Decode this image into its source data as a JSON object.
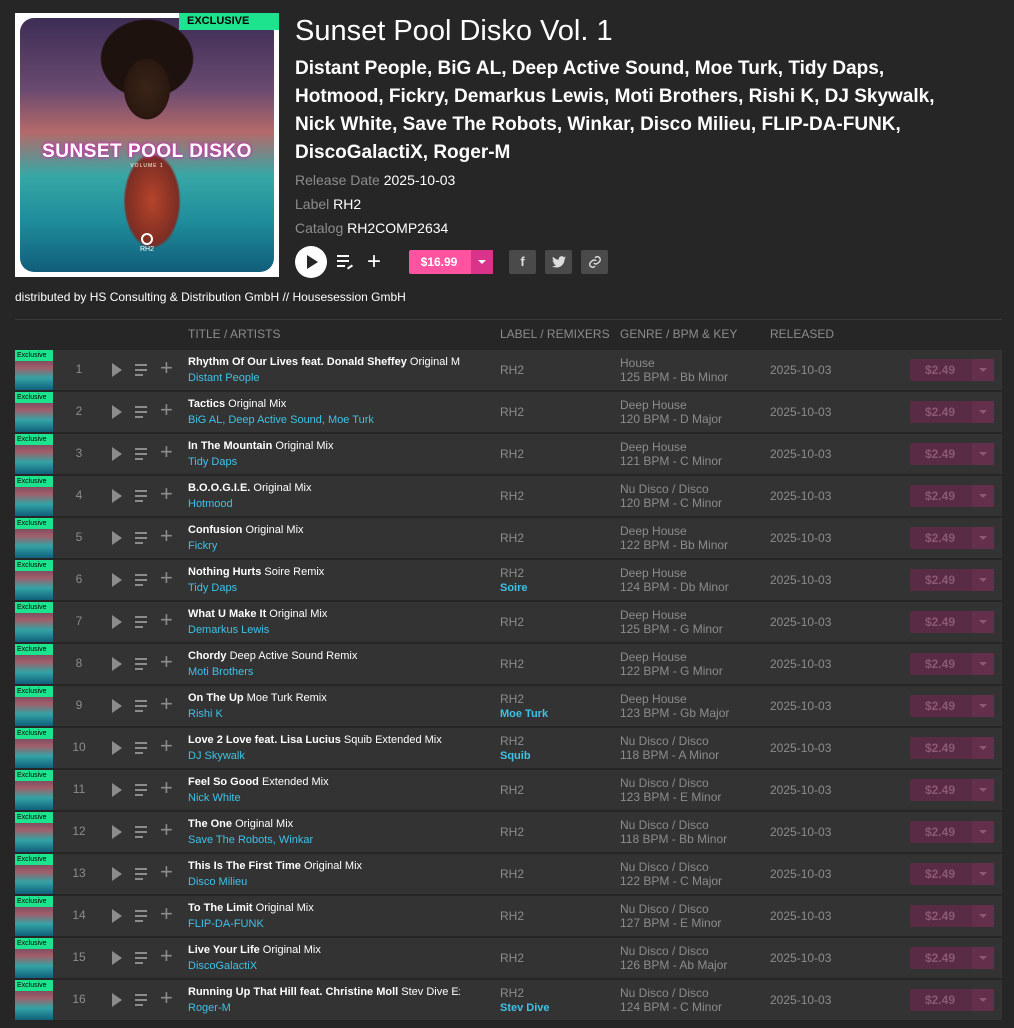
{
  "release": {
    "exclusive_tag": "EXCLUSIVE",
    "cover_title": "SUNSET POOL DISKO",
    "cover_subtitle": "VOLUME 1",
    "cover_logo": "RH2",
    "title": "Sunset Pool Disko Vol. 1",
    "artists": "Distant People, BiG AL, Deep Active Sound, Moe Turk, Tidy Daps, Hotmood, Fickry, Demarkus Lewis, Moti Brothers, Rishi K, DJ Skywalk, Nick White, Save The Robots, Winkar, Disco Milieu, FLIP-DA-FUNK, DiscoGalactiX, Roger-M",
    "release_date_label": "Release Date",
    "release_date": "2025-10-03",
    "label_label": "Label",
    "label": "RH2",
    "catalog_label": "Catalog",
    "catalog": "RH2COMP2634",
    "price": "$16.99",
    "distributed_by": "distributed by HS Consulting & Distribution GmbH // Housesession GmbH"
  },
  "social": {
    "facebook": "f",
    "twitter": "t",
    "link": "link"
  },
  "columns": {
    "title": "TITLE / ARTISTS",
    "label": "LABEL / REMIXERS",
    "genre": "GENRE / BPM & KEY",
    "released": "RELEASED"
  },
  "colors": {
    "accent_green": "#1ee38e",
    "price_pink": "#ff53a0",
    "artist_blue": "#3ec2e8",
    "background": "#262626",
    "row": "#333333"
  },
  "tracks": [
    {
      "num": "1",
      "title": "Rhythm Of Our Lives feat. Donald Sheffey",
      "mix": "Original Mix",
      "artists": "Distant People",
      "label": "RH2",
      "remixer": "",
      "genre": "House",
      "bpm_key": "125 BPM - Bb Minor",
      "released": "2025-10-03",
      "price": "$2.49",
      "exclusive": "Exclusive"
    },
    {
      "num": "2",
      "title": "Tactics",
      "mix": "Original Mix",
      "artists": "BiG AL, Deep Active Sound, Moe Turk",
      "label": "RH2",
      "remixer": "",
      "genre": "Deep House",
      "bpm_key": "120 BPM - D Major",
      "released": "2025-10-03",
      "price": "$2.49",
      "exclusive": "Exclusive"
    },
    {
      "num": "3",
      "title": "In The Mountain",
      "mix": "Original Mix",
      "artists": "Tidy Daps",
      "label": "RH2",
      "remixer": "",
      "genre": "Deep House",
      "bpm_key": "121 BPM - C Minor",
      "released": "2025-10-03",
      "price": "$2.49",
      "exclusive": "Exclusive"
    },
    {
      "num": "4",
      "title": "B.O.O.G.I.E.",
      "mix": "Original Mix",
      "artists": "Hotmood",
      "label": "RH2",
      "remixer": "",
      "genre": "Nu Disco / Disco",
      "bpm_key": "120 BPM - C Minor",
      "released": "2025-10-03",
      "price": "$2.49",
      "exclusive": "Exclusive"
    },
    {
      "num": "5",
      "title": "Confusion",
      "mix": "Original Mix",
      "artists": "Fickry",
      "label": "RH2",
      "remixer": "",
      "genre": "Deep House",
      "bpm_key": "122 BPM - Bb Minor",
      "released": "2025-10-03",
      "price": "$2.49",
      "exclusive": "Exclusive"
    },
    {
      "num": "6",
      "title": "Nothing Hurts",
      "mix": "Soire Remix",
      "artists": "Tidy Daps",
      "label": "RH2",
      "remixer": "Soire",
      "genre": "Deep House",
      "bpm_key": "124 BPM - Db Minor",
      "released": "2025-10-03",
      "price": "$2.49",
      "exclusive": "Exclusive"
    },
    {
      "num": "7",
      "title": "What U Make It",
      "mix": "Original Mix",
      "artists": "Demarkus Lewis",
      "label": "RH2",
      "remixer": "",
      "genre": "Deep House",
      "bpm_key": "125 BPM - G Minor",
      "released": "2025-10-03",
      "price": "$2.49",
      "exclusive": "Exclusive"
    },
    {
      "num": "8",
      "title": "Chordy",
      "mix": "Deep Active Sound Remix",
      "artists": "Moti Brothers",
      "label": "RH2",
      "remixer": "",
      "genre": "Deep House",
      "bpm_key": "122 BPM - G Minor",
      "released": "2025-10-03",
      "price": "$2.49",
      "exclusive": "Exclusive"
    },
    {
      "num": "9",
      "title": "On The Up",
      "mix": "Moe Turk Remix",
      "artists": "Rishi K",
      "label": "RH2",
      "remixer": "Moe Turk",
      "genre": "Deep House",
      "bpm_key": "123 BPM - Gb Major",
      "released": "2025-10-03",
      "price": "$2.49",
      "exclusive": "Exclusive"
    },
    {
      "num": "10",
      "title": "Love 2 Love feat. Lisa Lucius",
      "mix": "Squib Extended Mix",
      "artists": "DJ Skywalk",
      "label": "RH2",
      "remixer": "Squib",
      "genre": "Nu Disco / Disco",
      "bpm_key": "118 BPM - A Minor",
      "released": "2025-10-03",
      "price": "$2.49",
      "exclusive": "Exclusive"
    },
    {
      "num": "11",
      "title": "Feel So Good",
      "mix": "Extended Mix",
      "artists": "Nick White",
      "label": "RH2",
      "remixer": "",
      "genre": "Nu Disco / Disco",
      "bpm_key": "123 BPM - E Minor",
      "released": "2025-10-03",
      "price": "$2.49",
      "exclusive": "Exclusive"
    },
    {
      "num": "12",
      "title": "The One",
      "mix": "Original Mix",
      "artists": "Save The Robots, Winkar",
      "label": "RH2",
      "remixer": "",
      "genre": "Nu Disco / Disco",
      "bpm_key": "118 BPM - Bb Minor",
      "released": "2025-10-03",
      "price": "$2.49",
      "exclusive": "Exclusive"
    },
    {
      "num": "13",
      "title": "This Is The First Time",
      "mix": "Original Mix",
      "artists": "Disco Milieu",
      "label": "RH2",
      "remixer": "",
      "genre": "Nu Disco / Disco",
      "bpm_key": "122 BPM - C Major",
      "released": "2025-10-03",
      "price": "$2.49",
      "exclusive": "Exclusive"
    },
    {
      "num": "14",
      "title": "To The Limit",
      "mix": "Original Mix",
      "artists": "FLIP-DA-FUNK",
      "label": "RH2",
      "remixer": "",
      "genre": "Nu Disco / Disco",
      "bpm_key": "127 BPM - E Minor",
      "released": "2025-10-03",
      "price": "$2.49",
      "exclusive": "Exclusive"
    },
    {
      "num": "15",
      "title": "Live Your Life",
      "mix": "Original Mix",
      "artists": "DiscoGalactiX",
      "label": "RH2",
      "remixer": "",
      "genre": "Nu Disco / Disco",
      "bpm_key": "126 BPM - Ab Major",
      "released": "2025-10-03",
      "price": "$2.49",
      "exclusive": "Exclusive"
    },
    {
      "num": "16",
      "title": "Running Up That Hill feat. Christine Moll",
      "mix": "Stev Dive Ext",
      "artists": "Roger-M",
      "label": "RH2",
      "remixer": "Stev Dive",
      "genre": "Nu Disco / Disco",
      "bpm_key": "124 BPM - C Minor",
      "released": "2025-10-03",
      "price": "$2.49",
      "exclusive": "Exclusive"
    }
  ]
}
